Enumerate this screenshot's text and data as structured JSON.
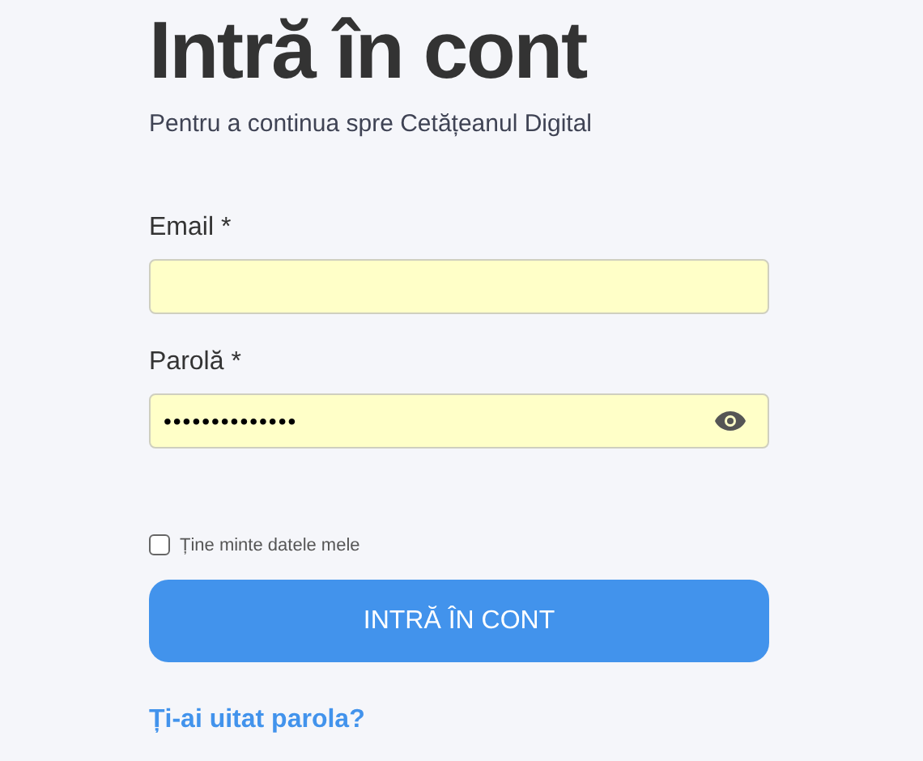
{
  "title": "Intră în cont",
  "subtitle": "Pentru a continua spre Cetățeanul Digital",
  "fields": [
    {
      "label": "Email *",
      "kind": "text"
    },
    {
      "label": "Parolă *",
      "value": "••••••••••••••",
      "kind": "password"
    }
  ],
  "remember": {
    "label": "Ține minte datele mele",
    "checked": false
  },
  "submit": "INTRĂ ÎN CONT",
  "forgot_link": "Ți-ai uitat parola?"
}
